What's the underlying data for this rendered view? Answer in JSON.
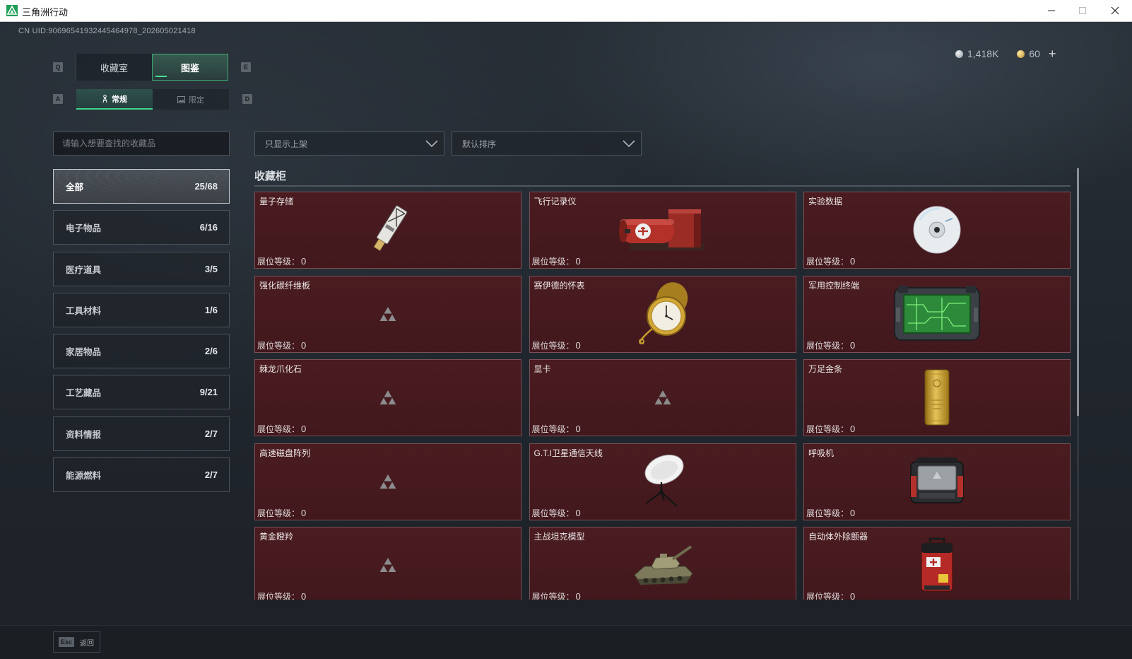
{
  "window": {
    "title": "三角洲行动",
    "logo_icon": "delta-logo-icon",
    "minimize_icon": "minimize-icon",
    "maximize_icon": "maximize-icon",
    "close_icon": "close-icon"
  },
  "uid": "CN UID:90696541932445464978_202605021418",
  "currency": {
    "coins": "1,418K",
    "premium": "60",
    "add": "+"
  },
  "tabs": {
    "prev_key": "Q",
    "next_key": "E",
    "items": [
      {
        "label": "收藏室",
        "active": false
      },
      {
        "label": "图鉴",
        "active": true
      }
    ]
  },
  "subtabs": {
    "prev_key": "A",
    "next_key": "D",
    "items": [
      {
        "label": "常规",
        "icon": "figure-icon",
        "active": true
      },
      {
        "label": "限定",
        "icon": "image-icon",
        "active": false
      }
    ]
  },
  "search": {
    "placeholder": "请输入想要查找的收藏品",
    "value": ""
  },
  "filters": [
    {
      "value": "只显示上架"
    },
    {
      "value": "默认排序"
    }
  ],
  "categories": [
    {
      "label": "全部",
      "count": "25/68",
      "active": true
    },
    {
      "label": "电子物品",
      "count": "6/16",
      "active": false
    },
    {
      "label": "医疗道具",
      "count": "3/5",
      "active": false
    },
    {
      "label": "工具材料",
      "count": "1/6",
      "active": false
    },
    {
      "label": "家居物品",
      "count": "2/6",
      "active": false
    },
    {
      "label": "工艺藏品",
      "count": "9/21",
      "active": false
    },
    {
      "label": "资料情报",
      "count": "2/7",
      "active": false
    },
    {
      "label": "能源燃料",
      "count": "2/7",
      "active": false
    }
  ],
  "section_title": "收藏柜",
  "cards": [
    {
      "name": "量子存储",
      "level_label": "展位等级：",
      "level": "0",
      "icon": "usb-drive"
    },
    {
      "name": "飞行记录仪",
      "level_label": "展位等级：",
      "level": "0",
      "icon": "flight-recorder"
    },
    {
      "name": "实验数据",
      "level_label": "展位等级：",
      "level": "0",
      "icon": "data-disc"
    },
    {
      "name": "强化碳纤维板",
      "level_label": "展位等级：",
      "level": "0",
      "icon": "placeholder-logo"
    },
    {
      "name": "赛伊德的怀表",
      "level_label": "展位等级：",
      "level": "0",
      "icon": "pocket-watch"
    },
    {
      "name": "军用控制终端",
      "level_label": "展位等级：",
      "level": "0",
      "icon": "control-terminal"
    },
    {
      "name": "棘龙爪化石",
      "level_label": "展位等级：",
      "level": "0",
      "icon": "placeholder-logo"
    },
    {
      "name": "显卡",
      "level_label": "展位等级：",
      "level": "0",
      "icon": "placeholder-logo"
    },
    {
      "name": "万足金条",
      "level_label": "展位等级：",
      "level": "0",
      "icon": "gold-bar"
    },
    {
      "name": "高速磁盘阵列",
      "level_label": "展位等级：",
      "level": "0",
      "icon": "placeholder-logo"
    },
    {
      "name": "G.T.I卫星通信天线",
      "level_label": "展位等级：",
      "level": "0",
      "icon": "satellite-dish"
    },
    {
      "name": "呼吸机",
      "level_label": "展位等级：",
      "level": "0",
      "icon": "ventilator"
    },
    {
      "name": "黄金瞪羚",
      "level_label": "展位等级：",
      "level": "0",
      "icon": "placeholder-logo"
    },
    {
      "name": "主战坦克模型",
      "level_label": "展位等级：",
      "level": "0",
      "icon": "tank-model"
    },
    {
      "name": "自动体外除颤器",
      "level_label": "展位等级：",
      "level": "0",
      "icon": "defibrillator"
    }
  ],
  "footer": {
    "key": "Esc",
    "label": "返回"
  },
  "colors": {
    "accent": "#3fd68a",
    "card_bg": "#461a1f",
    "card_border": "#7a5055",
    "titlebar_bg": "#ffffff"
  }
}
